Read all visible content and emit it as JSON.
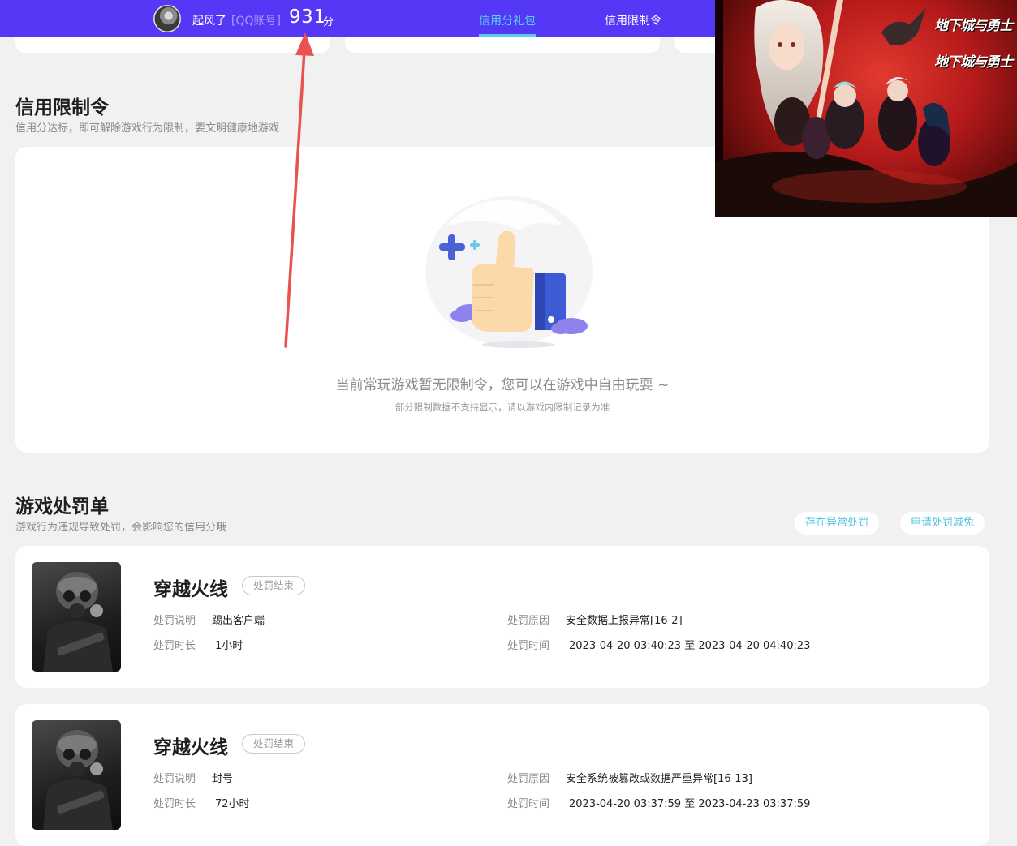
{
  "header": {
    "username": "起风了",
    "account_type": "[QQ账号]",
    "score": "931",
    "score_unit": "分",
    "tabs": [
      {
        "label": "信用分礼包",
        "active": true
      },
      {
        "label": "信用限制令",
        "active": false
      }
    ],
    "accent_color": "#5438f6",
    "active_tab_color": "#58d0ea"
  },
  "restriction_section": {
    "title": "信用限制令",
    "subtitle": "信用分达标，即可解除游戏行为限制，要文明健康地游戏",
    "empty_icon": "thumbs-up-icon",
    "empty_message": "当前常玩游戏暂无限制令，您可以在游戏中自由玩耍 ~",
    "empty_note": "部分限制数据不支持显示，请以游戏内限制记录为准"
  },
  "punishment_section": {
    "title": "游戏处罚单",
    "subtitle": "游戏行为违规导致处罚，会影响您的信用分哦",
    "buttons": {
      "abnormal": "存在异常处罚",
      "reduce": "申请处罚减免"
    },
    "field_labels": {
      "description": "处罚说明",
      "duration": "处罚时长",
      "reason": "处罚原因",
      "time": "处罚时间"
    },
    "records": [
      {
        "game": "穿越火线",
        "status": "处罚结束",
        "description": "踢出客户端",
        "duration": "1小时",
        "reason": "安全数据上报异常[16-2]",
        "time": "2023-04-20 03:40:23 至 2023-04-20 04:40:23"
      },
      {
        "game": "穿越火线",
        "status": "处罚结束",
        "description": "封号",
        "duration": "72小时",
        "reason": "安全系统被篡改或数据严重异常[16-13]",
        "time": "2023-04-20 03:37:59 至 2023-04-23 03:37:59"
      }
    ]
  },
  "ad_overlay": {
    "logo_text": "地下城与勇士"
  },
  "annotation": {
    "arrow_color": "#e8534f"
  }
}
